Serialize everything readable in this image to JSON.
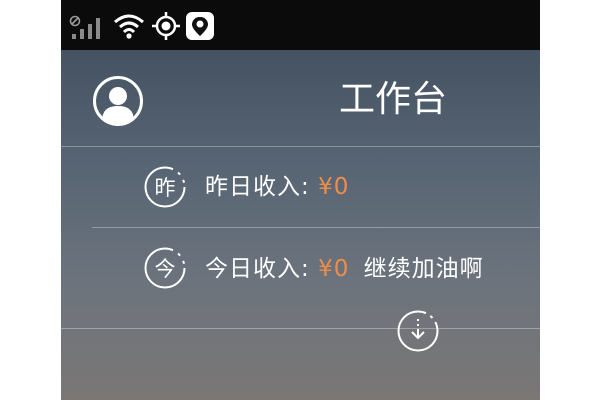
{
  "status_bar": {
    "icons": [
      "no-sim-icon",
      "signal-bars-icon",
      "wifi-icon",
      "gps-icon",
      "map-pin-icon"
    ]
  },
  "header": {
    "title": "工作台",
    "avatar_icon": "user-avatar-icon"
  },
  "income": {
    "yesterday": {
      "badge": "昨",
      "label": "昨日收入:",
      "amount": "¥0"
    },
    "today": {
      "badge": "今",
      "label": "今日收入:",
      "amount": "¥0",
      "note": "继续加油啊"
    }
  },
  "expand_icon": "expand-down-icon",
  "colors": {
    "accent": "#f08c4a",
    "status_bar": "#0b0b0c",
    "text": "#ffffff"
  }
}
